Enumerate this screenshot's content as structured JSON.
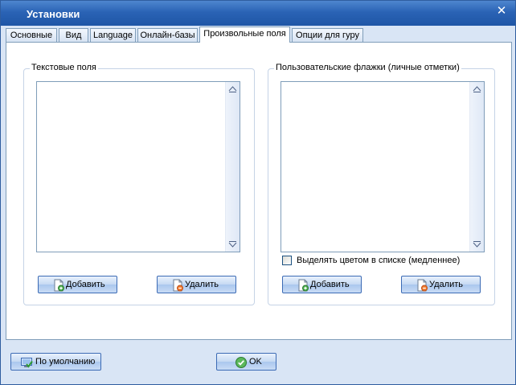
{
  "window": {
    "title": "Установки"
  },
  "tabs": [
    {
      "label": "Основные",
      "active": false
    },
    {
      "label": "Вид",
      "active": false
    },
    {
      "label": "Language",
      "active": false
    },
    {
      "label": "Онлайн-базы",
      "active": false
    },
    {
      "label": "Произвольные поля",
      "active": true
    },
    {
      "label": "Опции для гуру",
      "active": false
    }
  ],
  "text_fields_group": {
    "title": "Текстовые поля",
    "add_label": "Добавить",
    "delete_label": "Удалить"
  },
  "user_flags_group": {
    "title": "Пользовательские флажки (личные отметки)",
    "highlight_checkbox_label": "Выделять цветом в списке (медленнее)",
    "highlight_checked": false,
    "add_label": "Добавить",
    "delete_label": "Удалить"
  },
  "footer": {
    "default_label": "По умолчанию",
    "ok_label": "OK"
  },
  "icons": {
    "add": "add-document-icon",
    "delete": "delete-document-icon",
    "default": "default-settings-icon",
    "ok": "ok-check-icon",
    "close": "close-icon"
  },
  "colors": {
    "titlebar": "#2a63b5",
    "window_bg": "#d9e5f5",
    "border": "#7f9db9"
  }
}
